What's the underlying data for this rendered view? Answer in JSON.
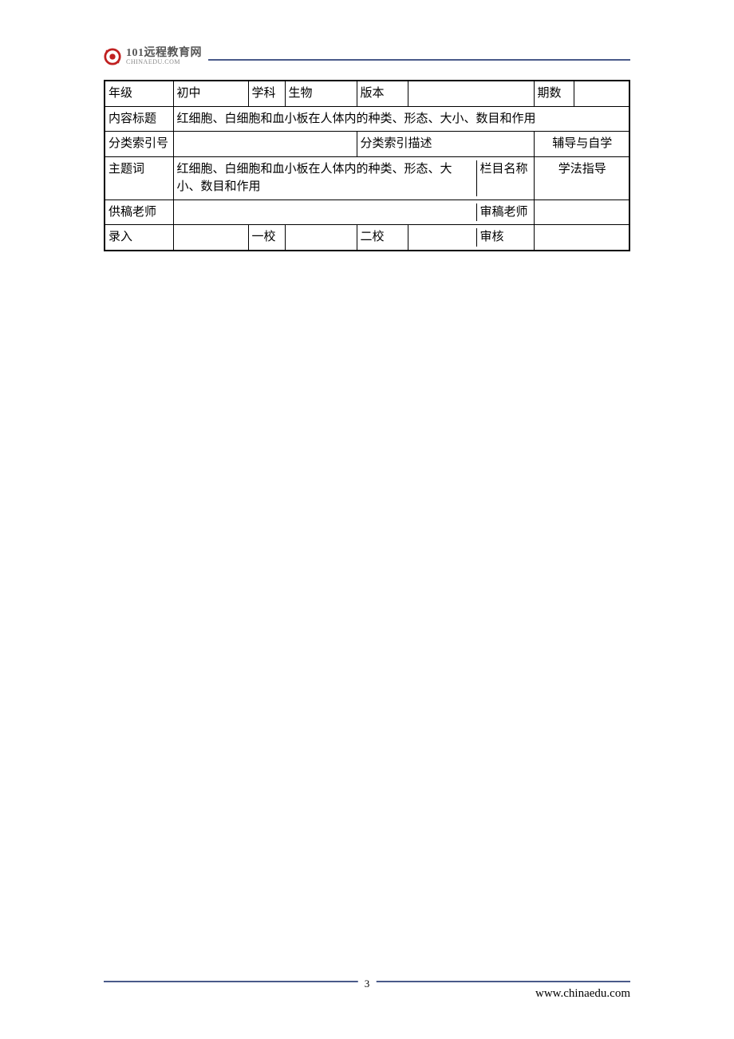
{
  "header": {
    "logo_title": "101远程教育网",
    "logo_sub": "CHINAEDU.COM"
  },
  "table": {
    "row1": {
      "grade_label": "年级",
      "grade_value": "初中",
      "subject_label": "学科",
      "subject_value": "生物",
      "version_label": "版本",
      "version_value": "",
      "issue_label": "期数",
      "issue_value": ""
    },
    "row2": {
      "content_title_label": "内容标题",
      "content_title_value": "红细胞、白细胞和血小板在人体内的种类、形态、大小、数目和作用"
    },
    "row3": {
      "index_no_label": "分类索引号",
      "index_no_value": "",
      "index_desc_label": "分类索引描述",
      "index_desc_value": "辅导与自学"
    },
    "row4": {
      "keyword_label": "主题词",
      "keyword_value": "红细胞、白细胞和血小板在人体内的种类、形态、大小、数目和作用",
      "column_name_label": "栏目名称",
      "column_name_value": "学法指导"
    },
    "row5": {
      "author_label": "供稿老师",
      "author_value": "",
      "reviewer_label": "审稿老师",
      "reviewer_value": ""
    },
    "row6": {
      "entry_label": "录入",
      "entry_value": "",
      "proof1_label": "一校",
      "proof1_value": "",
      "proof2_label": "二校",
      "proof2_value": "",
      "audit_label": "审核",
      "audit_value": ""
    }
  },
  "footer": {
    "page_number": "3",
    "url": "www.chinaedu.com"
  }
}
